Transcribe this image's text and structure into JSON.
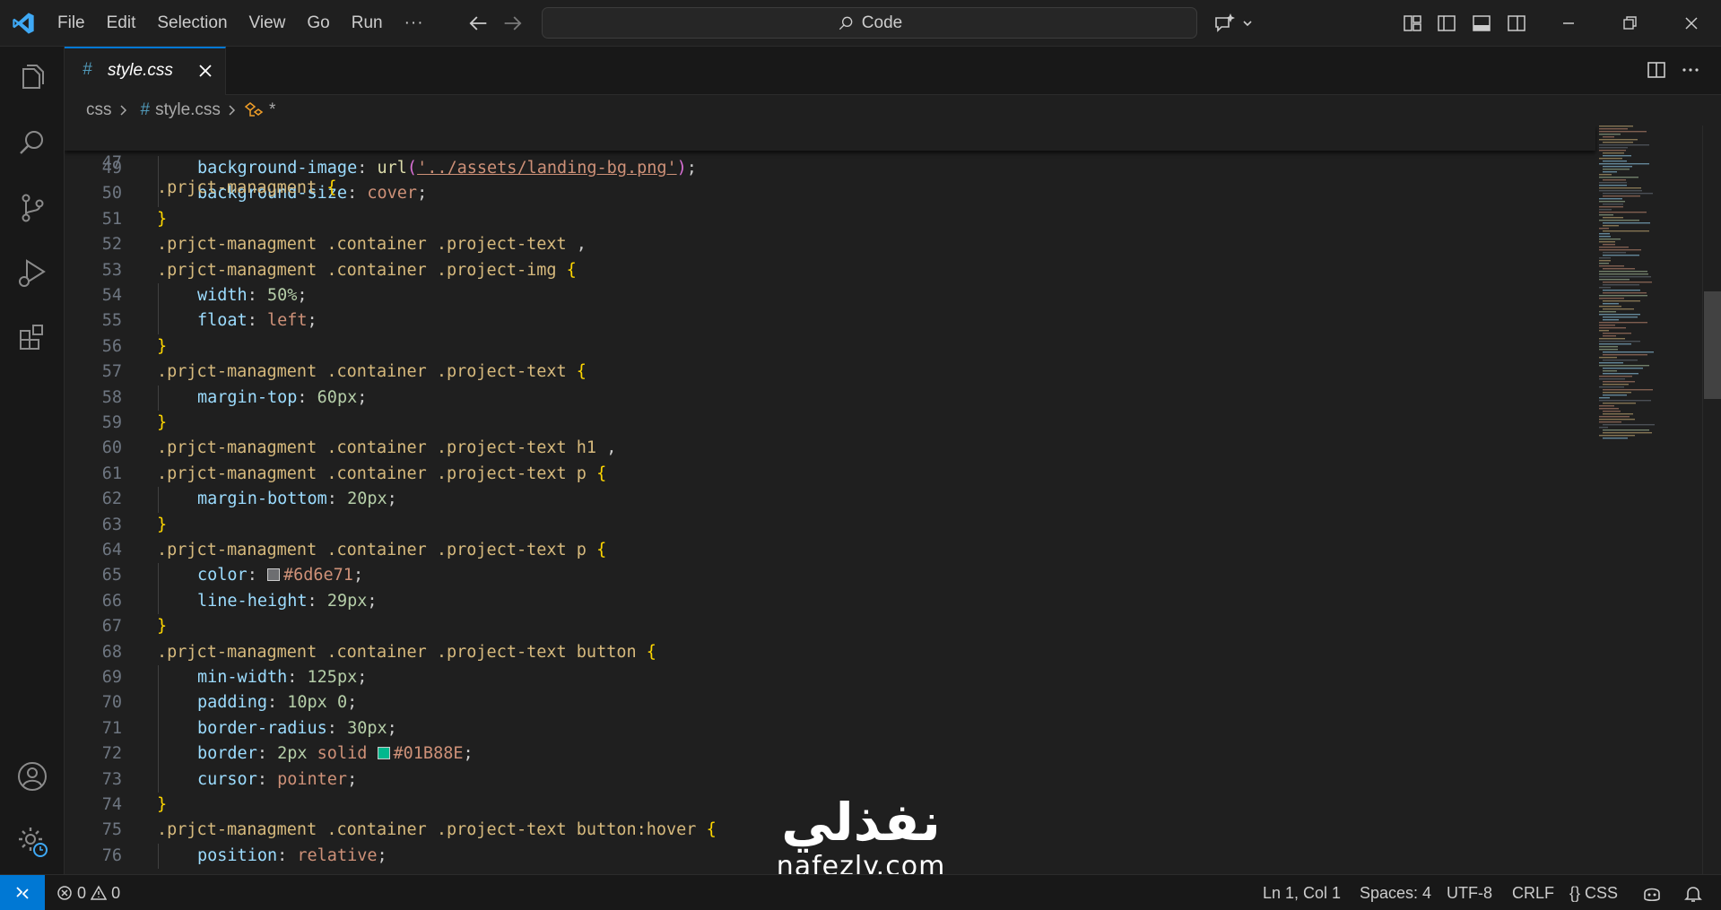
{
  "menu": {
    "items": [
      "File",
      "Edit",
      "Selection",
      "View",
      "Go",
      "Run"
    ],
    "more": "···"
  },
  "search": {
    "label": "Code"
  },
  "tab": {
    "label": "style.css",
    "icon_text": "#"
  },
  "breadcrumb": {
    "folder": "css",
    "file": "style.css",
    "hash": "#",
    "symbol": "*"
  },
  "sticky_line": {
    "number": "47",
    "tokens": [
      {
        "t": ".prjct-managment ",
        "c": "sel"
      },
      {
        "t": "{",
        "c": "brace"
      }
    ]
  },
  "code_lines": [
    {
      "n": "49",
      "indent": 1,
      "tokens": [
        {
          "t": "background-image",
          "c": "prop"
        },
        {
          "t": ": ",
          "c": "punc"
        },
        {
          "t": "url",
          "c": "fn"
        },
        {
          "t": "(",
          "c": "paren"
        },
        {
          "t": "'../assets/landing-bg.png'",
          "c": "str"
        },
        {
          "t": ")",
          "c": "paren"
        },
        {
          "t": ";",
          "c": "punc"
        }
      ]
    },
    {
      "n": "50",
      "indent": 1,
      "tokens": [
        {
          "t": "background-size",
          "c": "prop"
        },
        {
          "t": ": ",
          "c": "punc"
        },
        {
          "t": "cover",
          "c": "val"
        },
        {
          "t": ";",
          "c": "punc"
        }
      ]
    },
    {
      "n": "51",
      "indent": 0,
      "tokens": [
        {
          "t": "}",
          "c": "brace"
        }
      ]
    },
    {
      "n": "52",
      "indent": 0,
      "tokens": [
        {
          "t": ".prjct-managment .container .project-text ",
          "c": "sel"
        },
        {
          "t": ",",
          "c": "punc"
        }
      ]
    },
    {
      "n": "53",
      "indent": 0,
      "tokens": [
        {
          "t": ".prjct-managment .container .project-img ",
          "c": "sel"
        },
        {
          "t": "{",
          "c": "brace"
        }
      ]
    },
    {
      "n": "54",
      "indent": 1,
      "tokens": [
        {
          "t": "width",
          "c": "prop"
        },
        {
          "t": ": ",
          "c": "punc"
        },
        {
          "t": "50%",
          "c": "num"
        },
        {
          "t": ";",
          "c": "punc"
        }
      ]
    },
    {
      "n": "55",
      "indent": 1,
      "tokens": [
        {
          "t": "float",
          "c": "prop"
        },
        {
          "t": ": ",
          "c": "punc"
        },
        {
          "t": "left",
          "c": "val"
        },
        {
          "t": ";",
          "c": "punc"
        }
      ]
    },
    {
      "n": "56",
      "indent": 0,
      "tokens": [
        {
          "t": "}",
          "c": "brace"
        }
      ]
    },
    {
      "n": "57",
      "indent": 0,
      "tokens": [
        {
          "t": ".prjct-managment .container .project-text ",
          "c": "sel"
        },
        {
          "t": "{",
          "c": "brace"
        }
      ]
    },
    {
      "n": "58",
      "indent": 1,
      "tokens": [
        {
          "t": "margin-top",
          "c": "prop"
        },
        {
          "t": ": ",
          "c": "punc"
        },
        {
          "t": "60px",
          "c": "num"
        },
        {
          "t": ";",
          "c": "punc"
        }
      ]
    },
    {
      "n": "59",
      "indent": 0,
      "tokens": [
        {
          "t": "}",
          "c": "brace"
        }
      ]
    },
    {
      "n": "60",
      "indent": 0,
      "tokens": [
        {
          "t": ".prjct-managment .container .project-text h1 ",
          "c": "sel"
        },
        {
          "t": ",",
          "c": "punc"
        }
      ]
    },
    {
      "n": "61",
      "indent": 0,
      "tokens": [
        {
          "t": ".prjct-managment .container .project-text p ",
          "c": "sel"
        },
        {
          "t": "{",
          "c": "brace"
        }
      ]
    },
    {
      "n": "62",
      "indent": 1,
      "tokens": [
        {
          "t": "margin-bottom",
          "c": "prop"
        },
        {
          "t": ": ",
          "c": "punc"
        },
        {
          "t": "20px",
          "c": "num"
        },
        {
          "t": ";",
          "c": "punc"
        }
      ]
    },
    {
      "n": "63",
      "indent": 0,
      "tokens": [
        {
          "t": "}",
          "c": "brace"
        }
      ]
    },
    {
      "n": "64",
      "indent": 0,
      "tokens": [
        {
          "t": ".prjct-managment .container .project-text p ",
          "c": "sel"
        },
        {
          "t": "{",
          "c": "brace"
        }
      ]
    },
    {
      "n": "65",
      "indent": 1,
      "tokens": [
        {
          "t": "color",
          "c": "prop"
        },
        {
          "t": ": ",
          "c": "punc"
        },
        {
          "swatch": "#6d6e71"
        },
        {
          "t": "#6d6e71",
          "c": "val"
        },
        {
          "t": ";",
          "c": "punc"
        }
      ]
    },
    {
      "n": "66",
      "indent": 1,
      "tokens": [
        {
          "t": "line-height",
          "c": "prop"
        },
        {
          "t": ": ",
          "c": "punc"
        },
        {
          "t": "29px",
          "c": "num"
        },
        {
          "t": ";",
          "c": "punc"
        }
      ]
    },
    {
      "n": "67",
      "indent": 0,
      "tokens": [
        {
          "t": "}",
          "c": "brace"
        }
      ]
    },
    {
      "n": "68",
      "indent": 0,
      "tokens": [
        {
          "t": ".prjct-managment .container .project-text button ",
          "c": "sel"
        },
        {
          "t": "{",
          "c": "brace"
        }
      ]
    },
    {
      "n": "69",
      "indent": 1,
      "tokens": [
        {
          "t": "min-width",
          "c": "prop"
        },
        {
          "t": ": ",
          "c": "punc"
        },
        {
          "t": "125px",
          "c": "num"
        },
        {
          "t": ";",
          "c": "punc"
        }
      ]
    },
    {
      "n": "70",
      "indent": 1,
      "tokens": [
        {
          "t": "padding",
          "c": "prop"
        },
        {
          "t": ": ",
          "c": "punc"
        },
        {
          "t": "10px 0",
          "c": "num"
        },
        {
          "t": ";",
          "c": "punc"
        }
      ]
    },
    {
      "n": "71",
      "indent": 1,
      "tokens": [
        {
          "t": "border-radius",
          "c": "prop"
        },
        {
          "t": ": ",
          "c": "punc"
        },
        {
          "t": "30px",
          "c": "num"
        },
        {
          "t": ";",
          "c": "punc"
        }
      ]
    },
    {
      "n": "72",
      "indent": 1,
      "tokens": [
        {
          "t": "border",
          "c": "prop"
        },
        {
          "t": ": ",
          "c": "punc"
        },
        {
          "t": "2px",
          "c": "num"
        },
        {
          "t": " ",
          "c": "punc"
        },
        {
          "t": "solid",
          "c": "val"
        },
        {
          "t": " ",
          "c": "punc"
        },
        {
          "swatch": "#01B88E"
        },
        {
          "t": "#01B88E",
          "c": "val"
        },
        {
          "t": ";",
          "c": "punc"
        }
      ]
    },
    {
      "n": "73",
      "indent": 1,
      "tokens": [
        {
          "t": "cursor",
          "c": "prop"
        },
        {
          "t": ": ",
          "c": "punc"
        },
        {
          "t": "pointer",
          "c": "val"
        },
        {
          "t": ";",
          "c": "punc"
        }
      ]
    },
    {
      "n": "74",
      "indent": 0,
      "tokens": [
        {
          "t": "}",
          "c": "brace"
        }
      ]
    },
    {
      "n": "75",
      "indent": 0,
      "tokens": [
        {
          "t": ".prjct-managment .container .project-text button:hover ",
          "c": "sel"
        },
        {
          "t": "{",
          "c": "brace"
        }
      ]
    },
    {
      "n": "76",
      "indent": 1,
      "tokens": [
        {
          "t": "position",
          "c": "prop"
        },
        {
          "t": ": ",
          "c": "punc"
        },
        {
          "t": "relative",
          "c": "val"
        },
        {
          "t": ";",
          "c": "punc"
        }
      ]
    }
  ],
  "watermark": {
    "arabic": "نفذلي",
    "latin": "nafezly.com"
  },
  "status": {
    "errors": "0",
    "warnings": "0",
    "position": "Ln 1, Col 1",
    "spaces": "Spaces: 4",
    "encoding": "UTF-8",
    "eol": "CRLF",
    "language_brace": "{}",
    "language": "CSS"
  },
  "colors": {
    "accent": "#0078d4",
    "selector": "#d7ba7d",
    "property": "#9cdcfe",
    "value": "#ce9178",
    "number": "#b5cea8",
    "brace": "#ffd700"
  },
  "icons": {
    "activity": [
      "explorer-icon",
      "search-icon",
      "source-control-icon",
      "run-debug-icon",
      "extensions-icon",
      "account-icon",
      "settings-icon"
    ]
  }
}
